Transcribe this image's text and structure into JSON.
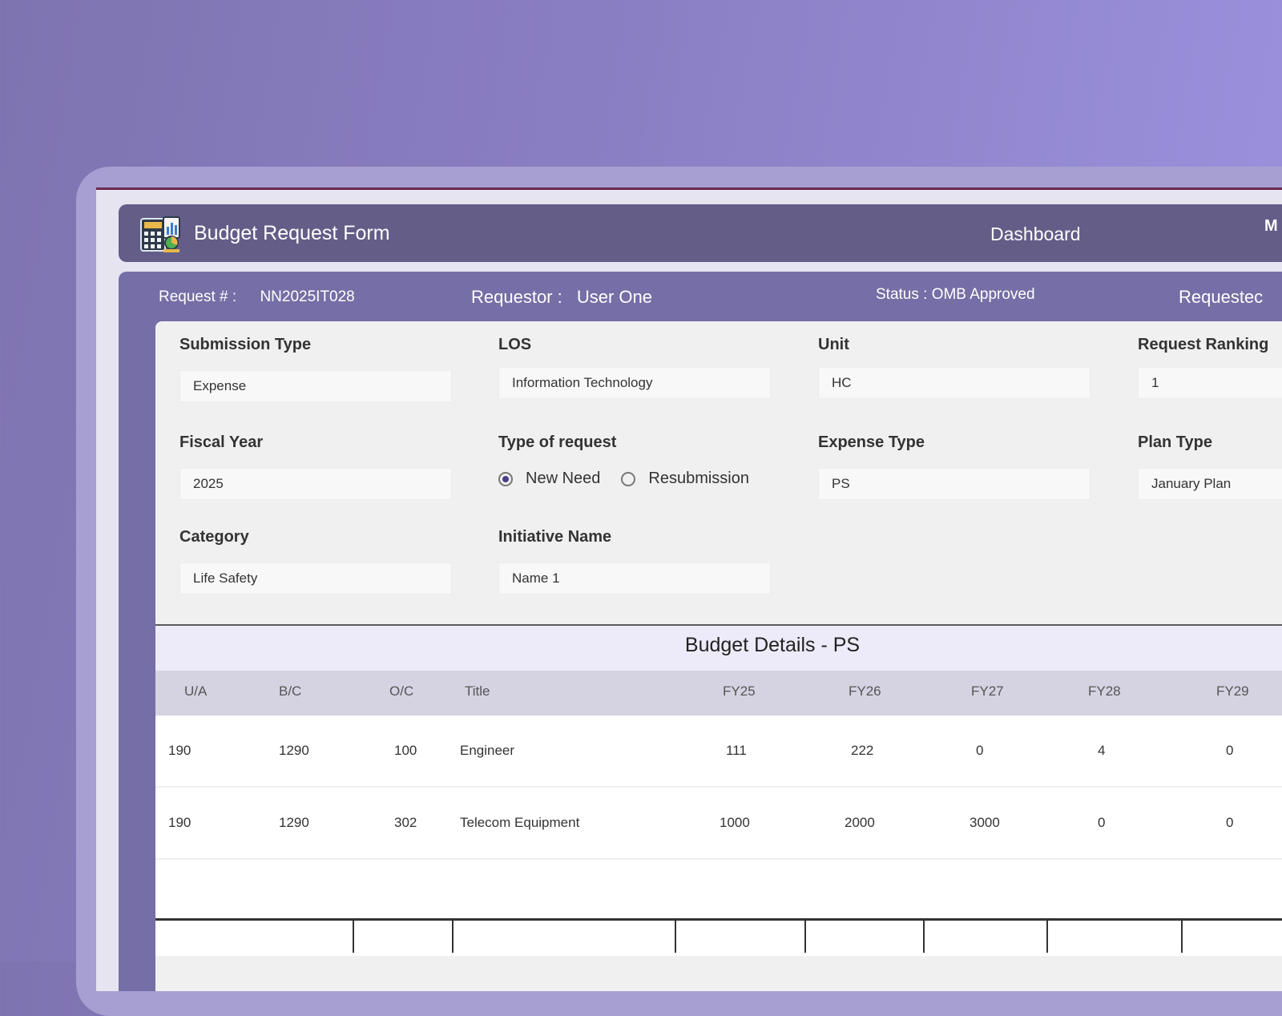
{
  "app": {
    "title": "Budget Request Form"
  },
  "nav": {
    "dashboard": "Dashboard",
    "more": "M"
  },
  "meta": {
    "request_label": "Request # :",
    "request_value": "NN2025IT028",
    "requestor_label": "Requestor :",
    "requestor_value": "User One",
    "status": "Status : OMB Approved",
    "requested_cut": "Requestec"
  },
  "form": {
    "submission_type": {
      "label": "Submission Type",
      "value": "Expense"
    },
    "los": {
      "label": "LOS",
      "value": "Information Technology"
    },
    "unit": {
      "label": "Unit",
      "value": "HC"
    },
    "request_ranking": {
      "label": "Request Ranking",
      "value": "1"
    },
    "fiscal_year": {
      "label": "Fiscal Year",
      "value": "2025"
    },
    "type_of_request": {
      "label": "Type of request",
      "options": [
        "New Need",
        "Resubmission"
      ],
      "selected": "New Need"
    },
    "expense_type": {
      "label": "Expense Type",
      "value": "PS"
    },
    "plan_type": {
      "label": "Plan Type",
      "value": "January Plan"
    },
    "category": {
      "label": "Category",
      "value": "Life Safety"
    },
    "initiative_name": {
      "label": "Initiative Name",
      "value": "Name 1"
    }
  },
  "budget": {
    "title": "Budget Details - PS",
    "columns": [
      "U/A",
      "B/C",
      "O/C",
      "Title",
      "FY25",
      "FY26",
      "FY27",
      "FY28",
      "FY29"
    ],
    "rows": [
      [
        "190",
        "1290",
        "100",
        "Engineer",
        "111",
        "222",
        "0",
        "4",
        "0"
      ],
      [
        "190",
        "1290",
        "302",
        "Telecom Equipment",
        "1000",
        "2000",
        "3000",
        "0",
        "0"
      ]
    ]
  }
}
